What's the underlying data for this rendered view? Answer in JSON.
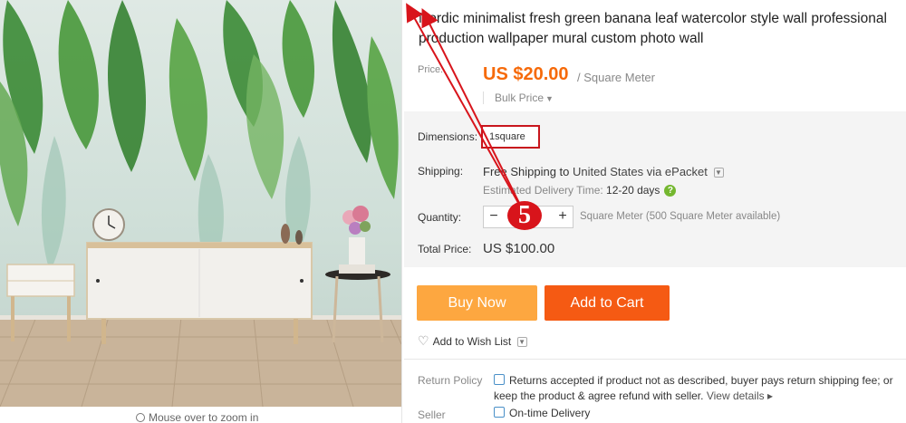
{
  "product": {
    "title": "Nordic minimalist fresh green banana leaf watercolor style wall professional production wallpaper mural custom photo wall"
  },
  "gallery": {
    "zoom_hint": "Mouse over to zoom in"
  },
  "price": {
    "label": "Price:",
    "value": "US $20.00",
    "unit": "/ Square Meter",
    "bulk_label": "Bulk Price"
  },
  "dimensions": {
    "label": "Dimensions:",
    "selected": "1square"
  },
  "shipping": {
    "label": "Shipping:",
    "free": "Free Shipping to",
    "destination": "United States via ePacket",
    "eta_label": "Estimated Delivery Time:",
    "eta_value": "12-20 days"
  },
  "quantity": {
    "label": "Quantity:",
    "value": "",
    "minus": "−",
    "plus": "+",
    "note": "Square Meter (500 Square Meter available)"
  },
  "total": {
    "label": "Total Price:",
    "value": "US $100.00"
  },
  "actions": {
    "buy_now": "Buy Now",
    "add_to_cart": "Add to Cart",
    "wish_list": "Add to Wish List"
  },
  "policy": {
    "return_label": "Return Policy",
    "return_text": "Returns accepted if product not as described, buyer pays return shipping fee; or keep the product & agree refund with seller.",
    "view_details": "View details",
    "seller_label": "Seller",
    "ontime": "On-time Delivery"
  },
  "annotation": {
    "step_number": "5",
    "color": "#d8141b"
  }
}
